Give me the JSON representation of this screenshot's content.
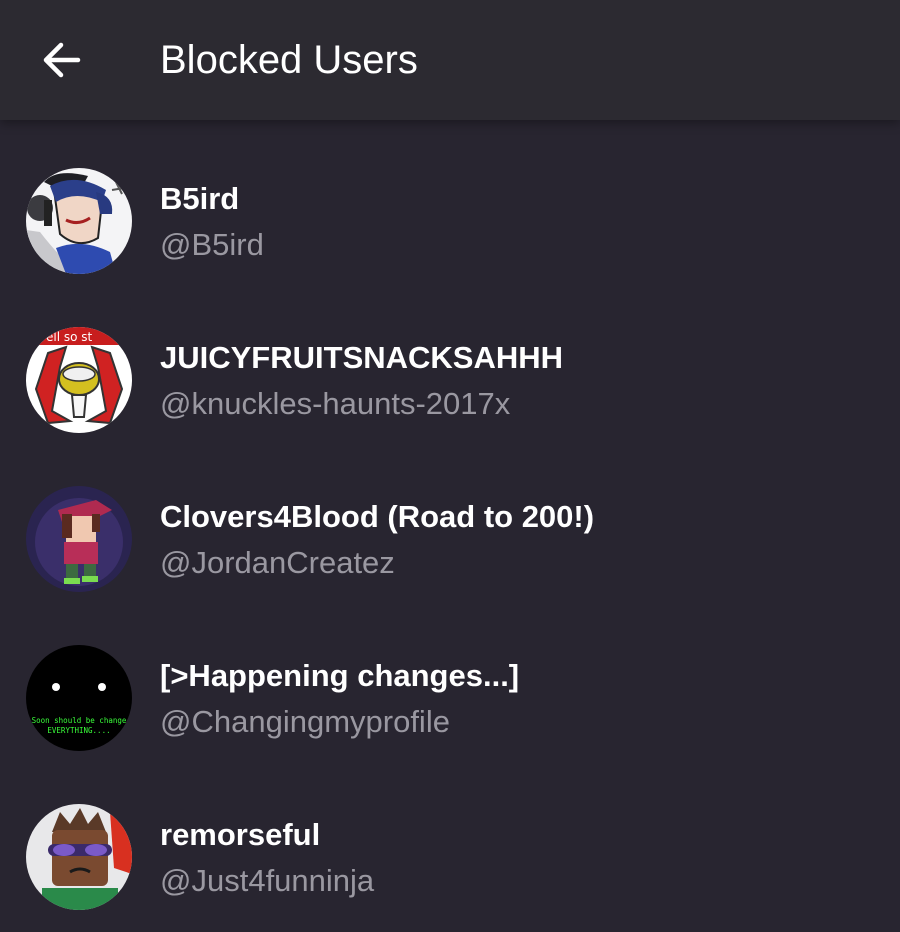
{
  "header": {
    "back_icon": "arrow-left-icon",
    "title": "Blocked Users"
  },
  "users": [
    {
      "display_name": "B5ird",
      "handle": "@B5ird",
      "avatar": "cartoon-character-avatar"
    },
    {
      "display_name": "JUICYFRUITSNACKSAHHH",
      "handle": "@knuckles-haunts-2017x",
      "avatar": "red-emblem-avatar",
      "avatar_text": "ell so st"
    },
    {
      "display_name": "Clovers4Blood (Road to 200!)",
      "handle": "@JordanCreatez",
      "avatar": "pixel-character-avatar"
    },
    {
      "display_name": "[>Happening changes...]",
      "handle": "@Changingmyprofile",
      "avatar": "black-eyes-avatar",
      "avatar_text_1": "Soon should be change",
      "avatar_text_2": "EVERYTHING...."
    },
    {
      "display_name": "remorseful",
      "handle": "@Just4funninja",
      "avatar": "roblox-character-avatar"
    }
  ],
  "colors": {
    "background": "#282530",
    "appbar": "#2c2a31",
    "primary_text": "#ffffff",
    "secondary_text": "#9a98a1"
  }
}
